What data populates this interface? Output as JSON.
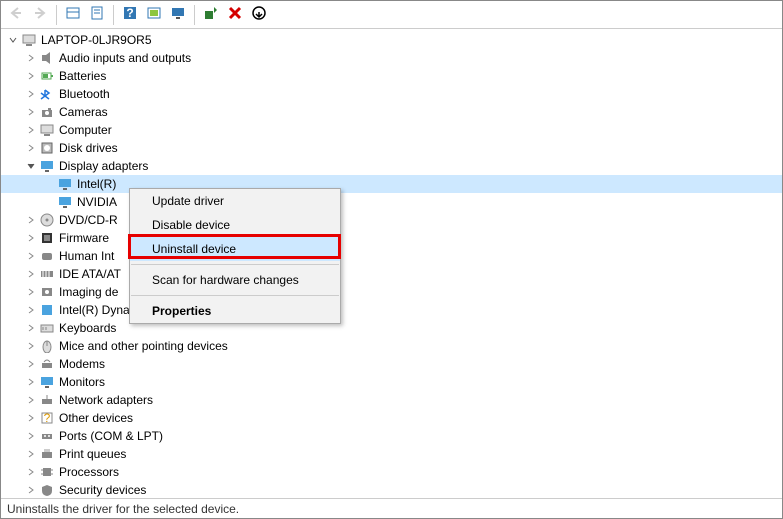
{
  "toolbar": {
    "back_icon": "back-arrow",
    "forward_icon": "forward-arrow",
    "show_hidden_icon": "show-hidden",
    "properties_icon": "properties",
    "help_icon": "help",
    "scan_icon": "scan-hardware",
    "monitor_icon": "remote",
    "add_legacy_icon": "add-legacy",
    "remove_icon": "remove",
    "update_icon": "update-driver"
  },
  "tree": {
    "root": {
      "label": "LAPTOP-0LJR9OR5",
      "icon": "computer"
    },
    "categories": [
      {
        "label": "Audio inputs and outputs",
        "icon": "audio",
        "expanded": false
      },
      {
        "label": "Batteries",
        "icon": "battery",
        "expanded": false
      },
      {
        "label": "Bluetooth",
        "icon": "bluetooth",
        "expanded": false
      },
      {
        "label": "Cameras",
        "icon": "camera",
        "expanded": false
      },
      {
        "label": "Computer",
        "icon": "computer",
        "expanded": false
      },
      {
        "label": "Disk drives",
        "icon": "disk",
        "expanded": false
      },
      {
        "label": "Display adapters",
        "icon": "display",
        "expanded": true,
        "children": [
          {
            "label": "Intel(R)",
            "icon": "display",
            "selected": true
          },
          {
            "label": "NVIDIA",
            "icon": "display"
          }
        ]
      },
      {
        "label": "DVD/CD-R",
        "icon": "optical",
        "expanded": false,
        "truncated": true
      },
      {
        "label": "Firmware",
        "icon": "firmware",
        "expanded": false
      },
      {
        "label": "Human Int",
        "icon": "hid",
        "expanded": false,
        "truncated": true
      },
      {
        "label": "IDE ATA/AT",
        "icon": "ide",
        "expanded": false,
        "truncated": true
      },
      {
        "label": "Imaging de",
        "icon": "imaging",
        "expanded": false,
        "truncated": true
      },
      {
        "label": "Intel(R) Dynamic Platform and Thermal Framework",
        "icon": "thermal",
        "expanded": false
      },
      {
        "label": "Keyboards",
        "icon": "keyboard",
        "expanded": false
      },
      {
        "label": "Mice and other pointing devices",
        "icon": "mouse",
        "expanded": false
      },
      {
        "label": "Modems",
        "icon": "modem",
        "expanded": false
      },
      {
        "label": "Monitors",
        "icon": "monitor",
        "expanded": false
      },
      {
        "label": "Network adapters",
        "icon": "network",
        "expanded": false
      },
      {
        "label": "Other devices",
        "icon": "other",
        "expanded": false
      },
      {
        "label": "Ports (COM & LPT)",
        "icon": "port",
        "expanded": false
      },
      {
        "label": "Print queues",
        "icon": "printer",
        "expanded": false
      },
      {
        "label": "Processors",
        "icon": "cpu",
        "expanded": false
      },
      {
        "label": "Security devices",
        "icon": "security",
        "expanded": false,
        "partial": true
      }
    ]
  },
  "context_menu": {
    "items": [
      {
        "label": "Update driver"
      },
      {
        "label": "Disable device"
      },
      {
        "label": "Uninstall device",
        "highlighted": true,
        "hover": true
      },
      {
        "separator": true
      },
      {
        "label": "Scan for hardware changes"
      },
      {
        "separator": true
      },
      {
        "label": "Properties",
        "bold": true
      }
    ]
  },
  "status_bar": {
    "text": "Uninstalls the driver for the selected device."
  },
  "colors": {
    "selection": "#cde8ff",
    "highlight_border": "#e60000"
  }
}
